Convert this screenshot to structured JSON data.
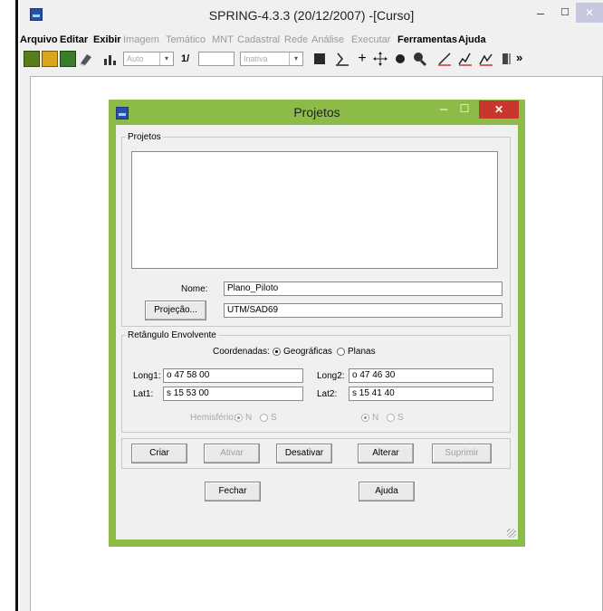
{
  "app": {
    "title": "SPRING-4.3.3 (20/12/2007) -[Curso]",
    "menu": [
      {
        "label": "Arquivo",
        "enabled": true
      },
      {
        "label": "Editar",
        "enabled": true
      },
      {
        "label": "Exibir",
        "enabled": true
      },
      {
        "label": "Imagem",
        "enabled": false
      },
      {
        "label": "Temático",
        "enabled": false
      },
      {
        "label": "MNT",
        "enabled": false
      },
      {
        "label": "Cadastral",
        "enabled": false
      },
      {
        "label": "Rede",
        "enabled": false
      },
      {
        "label": "Análise",
        "enabled": false
      },
      {
        "label": "Executar",
        "enabled": false
      },
      {
        "label": "Ferramentas",
        "enabled": true
      },
      {
        "label": "Ajuda",
        "enabled": true
      }
    ],
    "toolbar": {
      "auto_value": "Auto",
      "scale_label": "1/",
      "scale_value": "",
      "mode_value": "Inativa",
      "overflow": "»"
    }
  },
  "dialog": {
    "title": "Projetos",
    "projetos_group": "Projetos",
    "projects": [],
    "nome_label": "Nome:",
    "nome_value": "Plano_Piloto",
    "projecao_button": "Projeção...",
    "projecao_value": "UTM/SAD69",
    "retangulo_group": "Retângulo Envolvente",
    "coordenadas_label": "Coordenadas:",
    "coord_options": [
      "Geográficas",
      "Planas"
    ],
    "coord_selected": "Geográficas",
    "long1_label": "Long1:",
    "long1_value": "o 47 58 00",
    "long2_label": "Long2:",
    "long2_value": "o 47 46 30",
    "lat1_label": "Lat1:",
    "lat1_value": "s 15 53 00",
    "lat2_label": "Lat2:",
    "lat2_value": "s 15 41 40",
    "hemisferio_label": "Hemisfério:",
    "hemisferio_options": [
      "N",
      "S"
    ],
    "buttons": {
      "criar": "Criar",
      "ativar": "Ativar",
      "desativar": "Desativar",
      "alterar": "Alterar",
      "suprimir": "Suprimir",
      "fechar": "Fechar",
      "ajuda": "Ajuda"
    }
  }
}
